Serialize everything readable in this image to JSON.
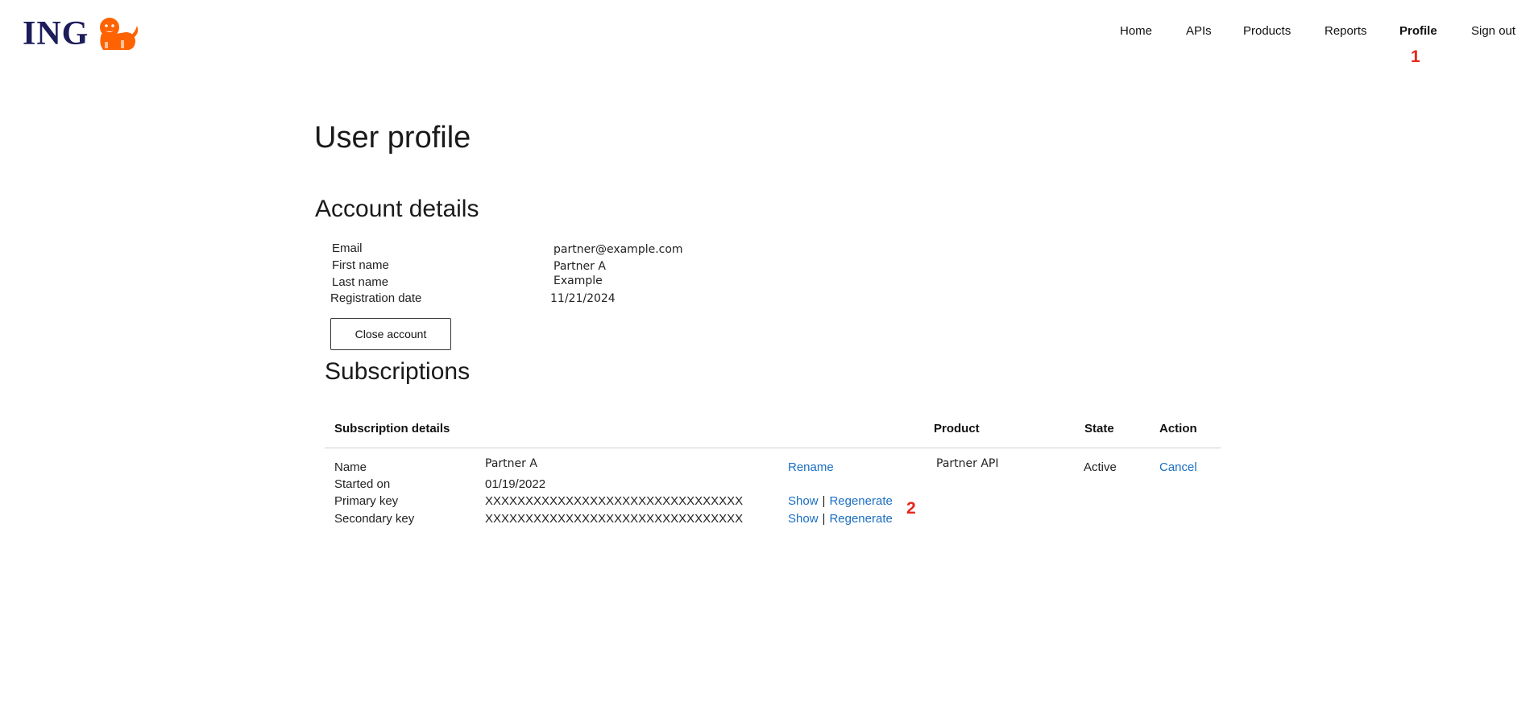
{
  "brand": {
    "name": "ING",
    "primary_color": "#1d1d5b",
    "accent_color": "#ff6200",
    "link_color": "#1a6ec2"
  },
  "nav": {
    "items": [
      {
        "label": "Home"
      },
      {
        "label": "APIs"
      },
      {
        "label": "Products"
      },
      {
        "label": "Reports"
      },
      {
        "label": "Profile",
        "active": true
      },
      {
        "label": "Sign out"
      }
    ],
    "marker": "1"
  },
  "page_title": "User profile",
  "account": {
    "title": "Account details",
    "fields": [
      {
        "label": "Email",
        "value": "partner@example.com"
      },
      {
        "label": "First name",
        "value": "Partner A"
      },
      {
        "label": "Last name",
        "value": "Example"
      },
      {
        "label": "Registration date",
        "value": "11/21/2024"
      }
    ],
    "close_button": "Close account"
  },
  "subscriptions": {
    "title": "Subscriptions",
    "headers": {
      "details": "Subscription details",
      "product": "Product",
      "state": "State",
      "action": "Action"
    },
    "rows": [
      {
        "label": "Name",
        "value": "Partner A",
        "link": "Rename"
      },
      {
        "label": "Started on",
        "value": "01/19/2022"
      },
      {
        "label": "Primary key",
        "value": "XXXXXXXXXXXXXXXXXXXXXXXXXXXXXXXX",
        "show": "Show",
        "regenerate": "Regenerate"
      },
      {
        "label": "Secondary key",
        "value": "XXXXXXXXXXXXXXXXXXXXXXXXXXXXXXXX",
        "show": "Show",
        "regenerate": "Regenerate"
      }
    ],
    "separator": "|",
    "product": "Partner API",
    "state": "Active",
    "action": "Cancel",
    "marker": "2"
  }
}
